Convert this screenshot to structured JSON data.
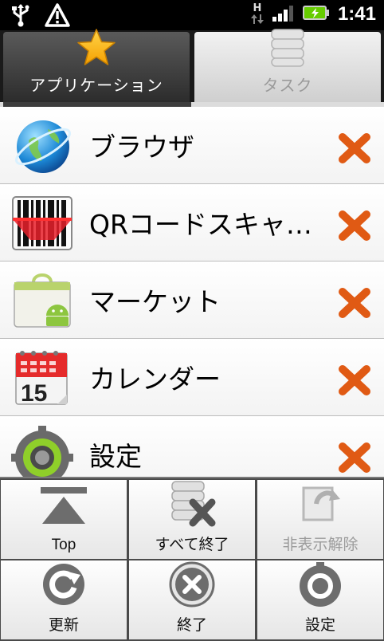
{
  "status_bar": {
    "time": "1:41",
    "network_type": "H",
    "icons": [
      "usb-icon",
      "warning-icon",
      "network-arrows-icon",
      "signal-icon",
      "battery-charging-icon"
    ]
  },
  "tabs": [
    {
      "label": "アプリケーション",
      "icon": "star-icon",
      "active": true
    },
    {
      "label": "タスク",
      "icon": "stack-icon",
      "active": false
    }
  ],
  "apps": [
    {
      "name": "ブラウザ",
      "icon": "globe-icon"
    },
    {
      "name": "QRコードスキャ…",
      "icon": "barcode-icon"
    },
    {
      "name": "マーケット",
      "icon": "market-icon"
    },
    {
      "name": "カレンダー",
      "icon": "calendar-icon",
      "calendar_day": "15"
    },
    {
      "name": "設定",
      "icon": "settings-icon"
    }
  ],
  "menu": [
    {
      "label": "Top",
      "icon": "top-arrow-icon",
      "enabled": true
    },
    {
      "label": "すべて終了",
      "icon": "stack-x-icon",
      "enabled": true
    },
    {
      "label": "非表示解除",
      "icon": "unhide-icon",
      "enabled": false
    },
    {
      "label": "更新",
      "icon": "refresh-icon",
      "enabled": true
    },
    {
      "label": "終了",
      "icon": "close-circle-icon",
      "enabled": true
    },
    {
      "label": "設定",
      "icon": "settings-ring-icon",
      "enabled": true
    }
  ],
  "colors": {
    "close_x": "#e05a14",
    "active_tab": "#3d3d3d",
    "battery": "#66cc00"
  }
}
